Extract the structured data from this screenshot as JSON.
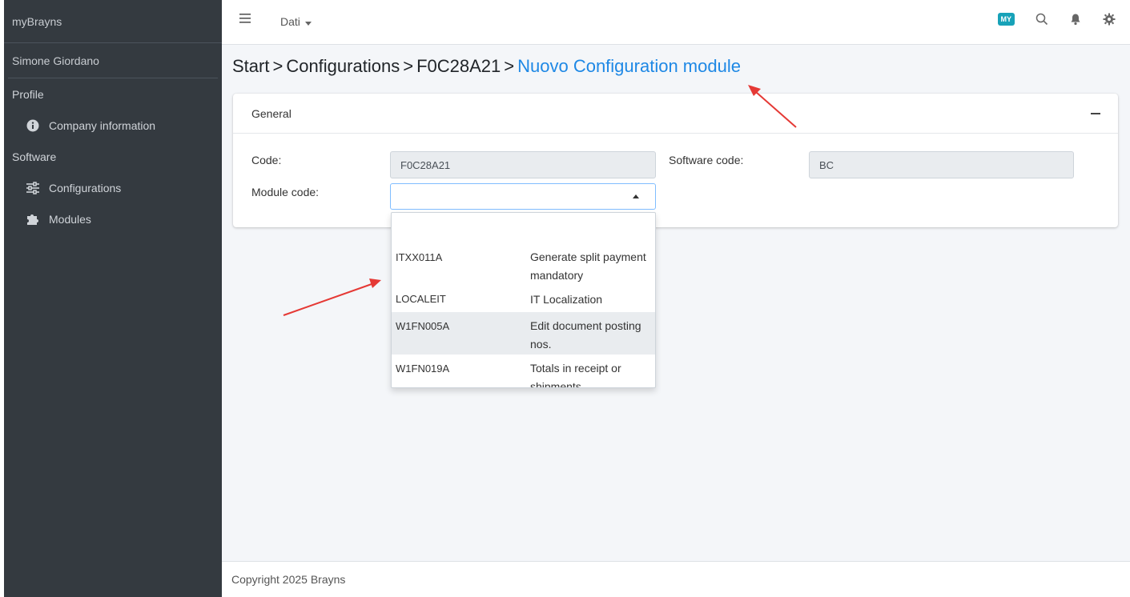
{
  "sidebar": {
    "brand": "myBrayns",
    "user": "Simone Giordano",
    "sections": [
      {
        "header": "Profile",
        "items": [
          {
            "label": "Company information",
            "icon": "info-circle-icon"
          }
        ]
      },
      {
        "header": "Software",
        "items": [
          {
            "label": "Configurations",
            "icon": "sliders-icon"
          },
          {
            "label": "Modules",
            "icon": "puzzle-icon"
          }
        ]
      }
    ]
  },
  "topbar": {
    "menu_label": "Dati",
    "badge": "MY"
  },
  "breadcrumb": {
    "items": [
      "Start",
      "Configurations",
      "F0C28A21"
    ],
    "separator": ">",
    "active": "Nuovo Configuration module"
  },
  "card": {
    "title": "General",
    "code_label": "Code:",
    "code_value": "F0C28A21",
    "software_code_label": "Software code:",
    "software_code_value": "BC",
    "module_code_label": "Module code:",
    "module_code_value": ""
  },
  "dropdown": {
    "options": [
      {
        "code": "ITXX011A",
        "description": "Generate split payment mandatory"
      },
      {
        "code": "LOCALEIT",
        "description": "IT Localization"
      },
      {
        "code": "W1FN005A",
        "description": "Edit document posting nos."
      },
      {
        "code": "W1FN019A",
        "description": "Totals in receipt or shipments"
      }
    ],
    "highlighted_index": 2
  },
  "footer": {
    "text": "Copyright 2025 Brayns"
  },
  "colors": {
    "sidebar": "#343a40",
    "accent": "#1e88e5",
    "badge": "#17a2b8",
    "annotation_arrow": "#e53935"
  }
}
